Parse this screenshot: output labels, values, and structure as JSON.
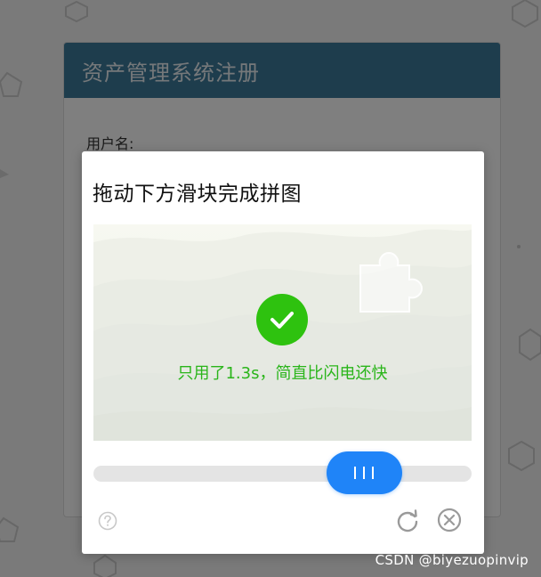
{
  "registration": {
    "title": "资产管理系统注册",
    "username_label": "用户名:"
  },
  "captcha": {
    "title": "拖动下方滑块完成拼图",
    "success_message": "只用了1.3s，简直比闪电还快",
    "slider_progress": 0.77,
    "icons": {
      "success": "check-circle-icon",
      "help": "question-circle-icon",
      "refresh": "refresh-icon",
      "close": "close-circle-icon",
      "handle": "grip-lines-icon"
    }
  },
  "watermark": "CSDN @biyezuopinvip",
  "colors": {
    "header_bg": "#3c7a9a",
    "success_green": "#2ec20f",
    "slider_blue": "#1f84f8",
    "track_gray": "#e4e4e4"
  }
}
